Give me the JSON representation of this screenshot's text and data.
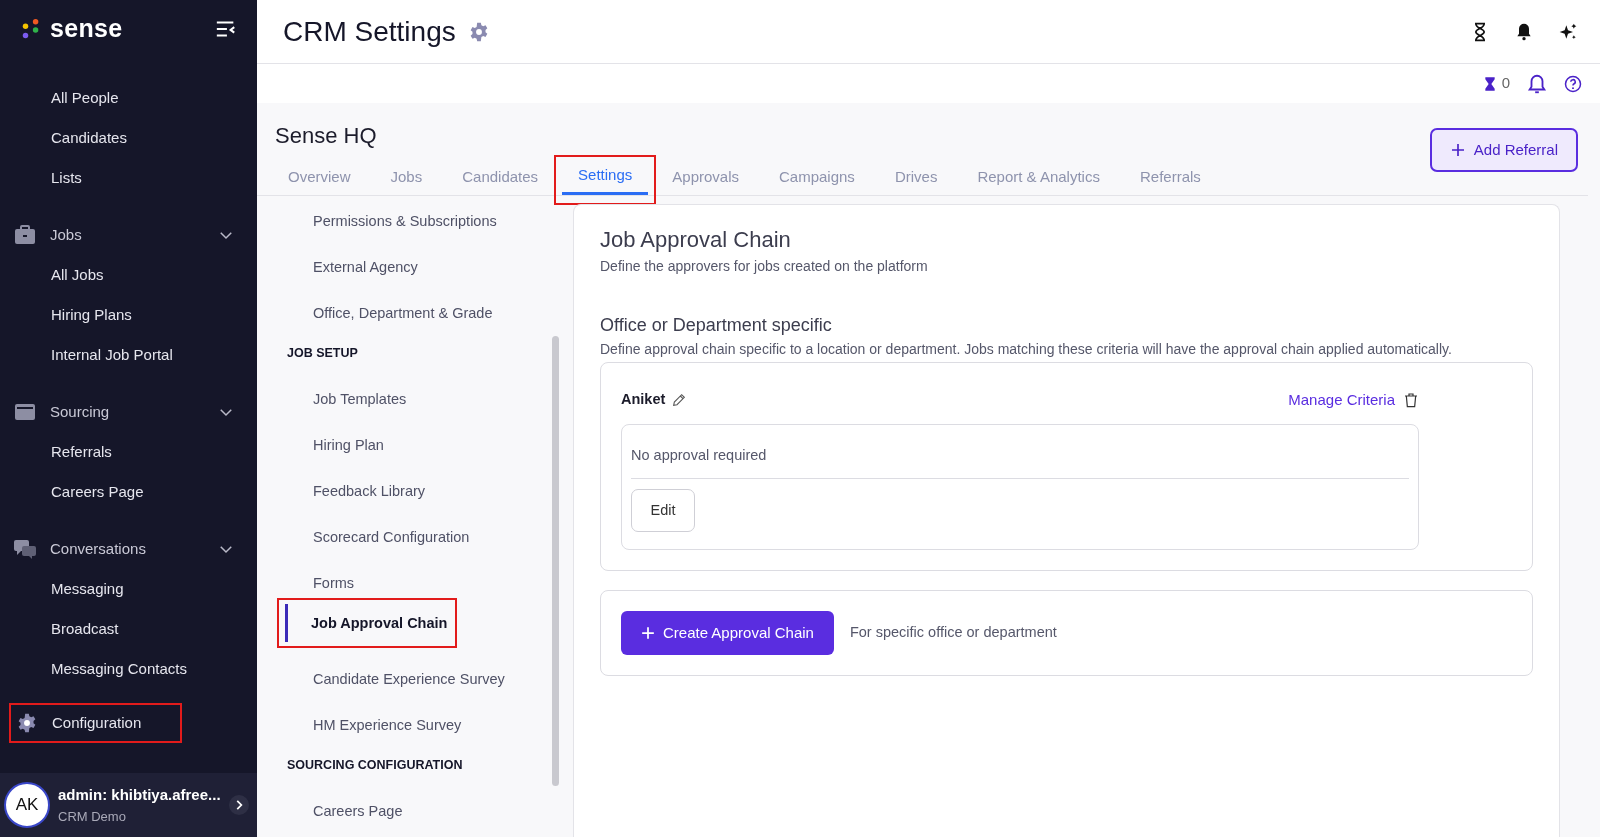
{
  "sidebar": {
    "brand": "sense",
    "items": [
      {
        "kind": "link",
        "label": "All People"
      },
      {
        "kind": "link",
        "label": "Candidates"
      },
      {
        "kind": "link",
        "label": "Lists"
      },
      {
        "kind": "group",
        "label": "Jobs",
        "expanded": true
      },
      {
        "kind": "link",
        "label": "All Jobs"
      },
      {
        "kind": "link",
        "label": "Hiring Plans"
      },
      {
        "kind": "link",
        "label": "Internal Job Portal"
      },
      {
        "kind": "group",
        "label": "Sourcing",
        "expanded": true
      },
      {
        "kind": "link",
        "label": "Referrals"
      },
      {
        "kind": "link",
        "label": "Careers Page"
      },
      {
        "kind": "group",
        "label": "Conversations",
        "expanded": true
      },
      {
        "kind": "link",
        "label": "Messaging"
      },
      {
        "kind": "link",
        "label": "Broadcast"
      },
      {
        "kind": "link",
        "label": "Messaging Contacts"
      },
      {
        "kind": "single",
        "label": "Configuration",
        "highlighted": true
      }
    ],
    "user": {
      "initials": "AK",
      "name": "admin: khibtiya.afree...",
      "org": "CRM Demo"
    }
  },
  "header": {
    "title": "CRM Settings",
    "counter": "0"
  },
  "page": {
    "title": "Sense HQ",
    "add_button": "Add Referral",
    "tabs": [
      {
        "label": "Overview",
        "selected": false,
        "highlighted": false
      },
      {
        "label": "Jobs",
        "selected": false,
        "highlighted": false
      },
      {
        "label": "Candidates",
        "selected": false,
        "highlighted": false
      },
      {
        "label": "Settings",
        "selected": true,
        "highlighted": true
      },
      {
        "label": "Approvals",
        "selected": false,
        "highlighted": false
      },
      {
        "label": "Campaigns",
        "selected": false,
        "highlighted": false
      },
      {
        "label": "Drives",
        "selected": false,
        "highlighted": false
      },
      {
        "label": "Report & Analytics",
        "selected": false,
        "highlighted": false
      },
      {
        "label": "Referrals",
        "selected": false,
        "highlighted": false
      }
    ]
  },
  "settings_nav": [
    {
      "kind": "link",
      "label": "Permissions & Subscriptions",
      "selected": false,
      "highlighted": false
    },
    {
      "kind": "link",
      "label": "External Agency",
      "selected": false,
      "highlighted": false
    },
    {
      "kind": "link",
      "label": "Office, Department & Grade",
      "selected": false,
      "highlighted": false
    },
    {
      "kind": "heading",
      "label": "JOB SETUP"
    },
    {
      "kind": "link",
      "label": "Job Templates",
      "selected": false,
      "highlighted": false
    },
    {
      "kind": "link",
      "label": "Hiring Plan",
      "selected": false,
      "highlighted": false
    },
    {
      "kind": "link",
      "label": "Feedback Library",
      "selected": false,
      "highlighted": false
    },
    {
      "kind": "link",
      "label": "Scorecard Configuration",
      "selected": false,
      "highlighted": false
    },
    {
      "kind": "link",
      "label": "Forms",
      "selected": false,
      "highlighted": false
    },
    {
      "kind": "link",
      "label": "Job Approval Chain",
      "selected": true,
      "highlighted": true
    },
    {
      "kind": "link",
      "label": "Candidate Experience Survey",
      "selected": false,
      "highlighted": false
    },
    {
      "kind": "link",
      "label": "HM Experience Survey",
      "selected": false,
      "highlighted": false
    },
    {
      "kind": "heading",
      "label": "SOURCING CONFIGURATION"
    },
    {
      "kind": "link",
      "label": "Careers Page",
      "selected": false,
      "highlighted": false
    }
  ],
  "content": {
    "title": "Job Approval Chain",
    "description": "Define the approvers for jobs created on the platform",
    "section_title": "Office or Department specific",
    "section_description": "Define approval chain specific to a location or department. Jobs matching these criteria will have the approval chain applied automatically.",
    "chains": [
      {
        "name": "Aniket",
        "manage": "Manage Criteria",
        "status": "No approval required",
        "edit": "Edit"
      }
    ],
    "create_button": "Create Approval Chain",
    "create_hint": "For specific office or department"
  }
}
